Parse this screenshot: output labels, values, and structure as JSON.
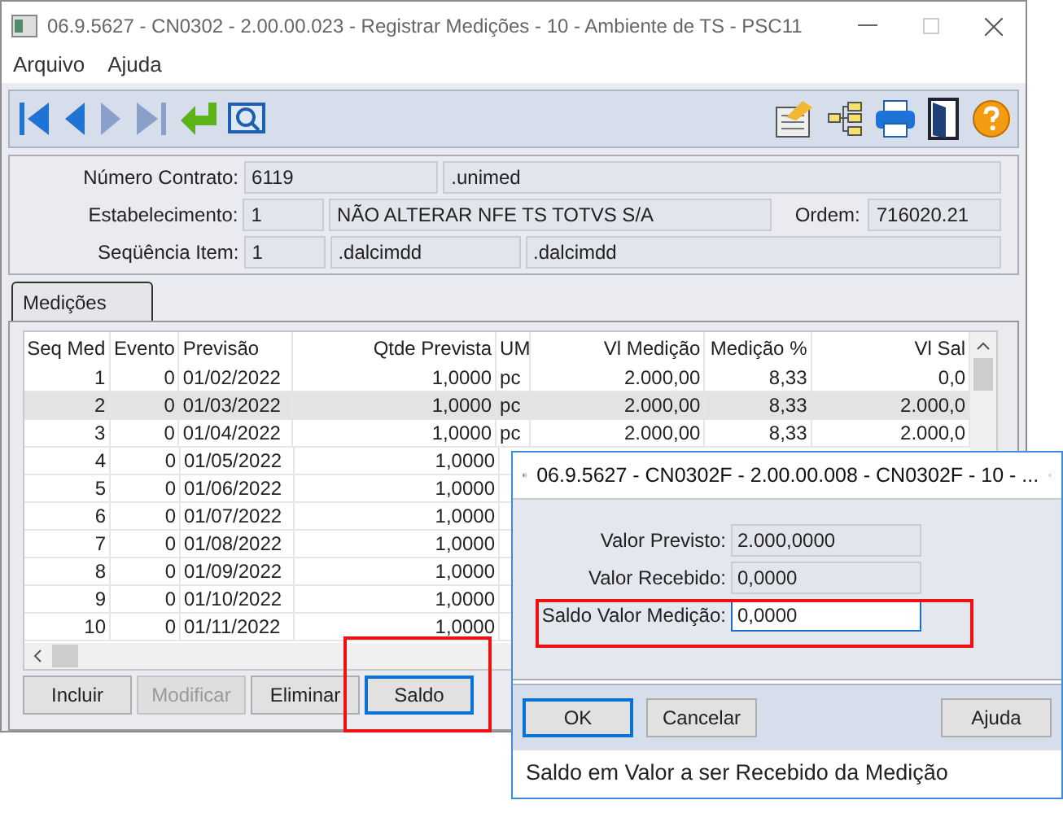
{
  "window": {
    "title": "06.9.5627 - CN0302 - 2.00.00.023 - Registrar Medições - 10 - Ambiente de TS - PSC11"
  },
  "menu": [
    "Arquivo",
    "Ajuda"
  ],
  "toolbar_left": [
    {
      "kind": "first"
    },
    {
      "kind": "prev"
    },
    {
      "kind": "next"
    },
    {
      "kind": "last"
    },
    {
      "kind": "confirm"
    },
    {
      "kind": "zoom"
    }
  ],
  "toolbar_right": [
    {
      "kind": "notes"
    },
    {
      "kind": "tree"
    },
    {
      "kind": "print"
    },
    {
      "kind": "exit"
    },
    {
      "kind": "help"
    }
  ],
  "header": [
    {
      "label": "Número Contrato:",
      "fields": [
        "6119",
        ".unimed"
      ]
    },
    {
      "label": "Estabelecimento:",
      "fields": [
        "1",
        "NÃO ALTERAR NFE TS TOTVS S/A"
      ],
      "extra_label": "Ordem:",
      "extra_field": "716020.21"
    },
    {
      "label": "Seqüência Item:",
      "fields": [
        "1",
        ".dalcimdd",
        ".dalcimdd"
      ]
    }
  ],
  "tabs": [
    {
      "label": "Medições",
      "selected": true
    }
  ],
  "table": {
    "columns": [
      "Seq Med",
      "Evento",
      "Previsão",
      "Qtde Prevista",
      "UM",
      "Vl Medição",
      "Medição %",
      "Vl Sal"
    ],
    "rows": [
      {
        "selected": false,
        "cells": [
          "1",
          "0",
          "01/02/2022",
          "1,0000",
          "pc",
          "2.000,00",
          "8,33",
          "0,0"
        ]
      },
      {
        "selected": true,
        "cells": [
          "2",
          "0",
          "01/03/2022",
          "1,0000",
          "pc",
          "2.000,00",
          "8,33",
          "2.000,0"
        ]
      },
      {
        "selected": false,
        "cells": [
          "3",
          "0",
          "01/04/2022",
          "1,0000",
          "pc",
          "2.000,00",
          "8,33",
          "2.000,0"
        ]
      },
      {
        "selected": false,
        "cells": [
          "4",
          "0",
          "01/05/2022",
          "1,0000"
        ]
      },
      {
        "selected": false,
        "cells": [
          "5",
          "0",
          "01/06/2022",
          "1,0000"
        ]
      },
      {
        "selected": false,
        "cells": [
          "6",
          "0",
          "01/07/2022",
          "1,0000"
        ]
      },
      {
        "selected": false,
        "cells": [
          "7",
          "0",
          "01/08/2022",
          "1,0000"
        ]
      },
      {
        "selected": false,
        "cells": [
          "8",
          "0",
          "01/09/2022",
          "1,0000"
        ]
      },
      {
        "selected": false,
        "cells": [
          "9",
          "0",
          "01/10/2022",
          "1,0000"
        ]
      },
      {
        "selected": false,
        "cells": [
          "10",
          "0",
          "01/11/2022",
          "1,0000"
        ]
      }
    ]
  },
  "buttons": [
    {
      "label": "Incluir",
      "disabled": false,
      "focused": false
    },
    {
      "label": "Modificar",
      "disabled": true,
      "focused": false
    },
    {
      "label": "Eliminar",
      "disabled": false,
      "focused": false
    },
    {
      "label": "Saldo",
      "disabled": false,
      "focused": true
    }
  ],
  "dialog": {
    "title": "06.9.5627 - CN0302F - 2.00.00.008 - CN0302F - 10 - ...",
    "fields": [
      {
        "label": "Valor Previsto:",
        "value": "2.000,0000",
        "editable": false
      },
      {
        "label": "Valor Recebido:",
        "value": "0,0000",
        "editable": false
      },
      {
        "label": "Saldo Valor Medição:",
        "value": "0,0000",
        "editable": true
      }
    ],
    "buttons": [
      {
        "label": "OK",
        "focused": true
      },
      {
        "label": "Cancelar",
        "focused": false
      },
      {
        "label": "Ajuda",
        "focused": false
      }
    ],
    "status": "Saldo em Valor a ser Recebido da Medição"
  }
}
